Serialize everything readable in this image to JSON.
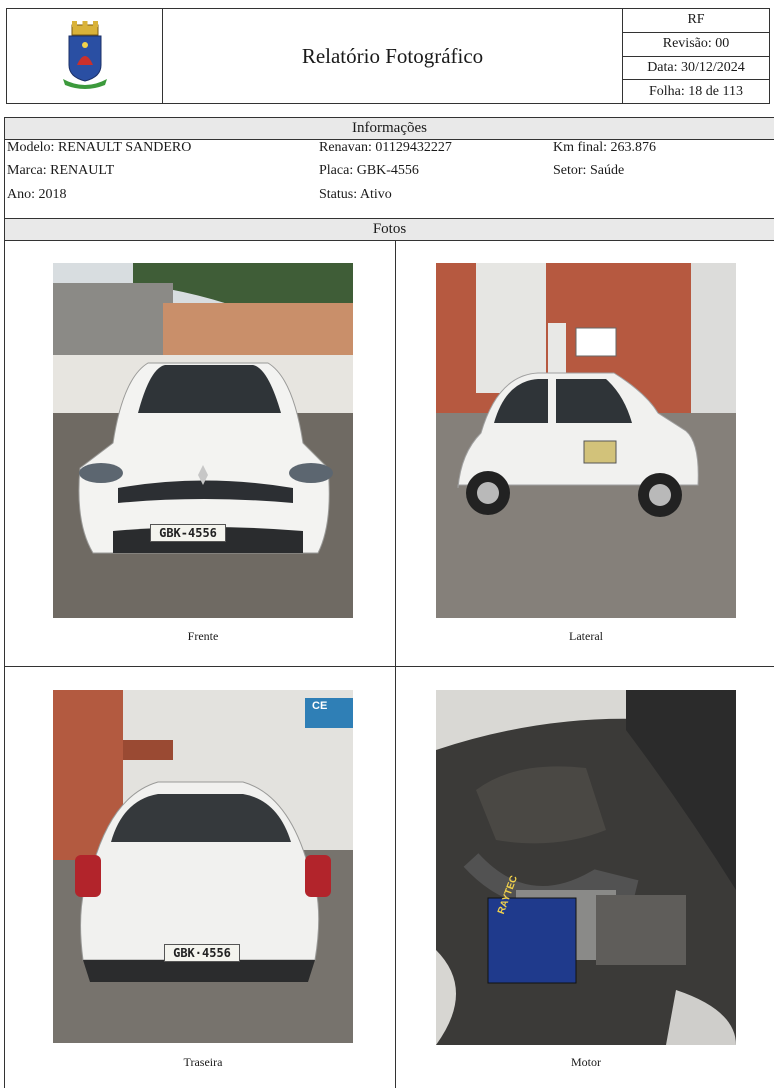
{
  "header": {
    "title": "Relatório Fotográfico",
    "code": "RF",
    "revision": "Revisão: 00",
    "date": "Data: 30/12/2024",
    "sheet": "Folha: 18 de 113"
  },
  "info": {
    "section_title": "Informações",
    "modelo": "Modelo: RENAULT SANDERO",
    "marca": "Marca: RENAULT",
    "ano": "Ano: 2018",
    "renavan": "Renavan: 01129432227",
    "placa": "Placa: GBK-4556",
    "status": "Status: Ativo",
    "km_final": "Km final: 263.876",
    "setor": "Setor: Saúde"
  },
  "photos": {
    "section_title": "Fotos",
    "captions": [
      "Frente",
      "Lateral",
      "Traseira",
      "Motor"
    ],
    "plate_text": "GBK-4556",
    "plate_text_rear": "GBK·4556",
    "battery_brand": "RAYTEC",
    "building_sign": "CE"
  }
}
